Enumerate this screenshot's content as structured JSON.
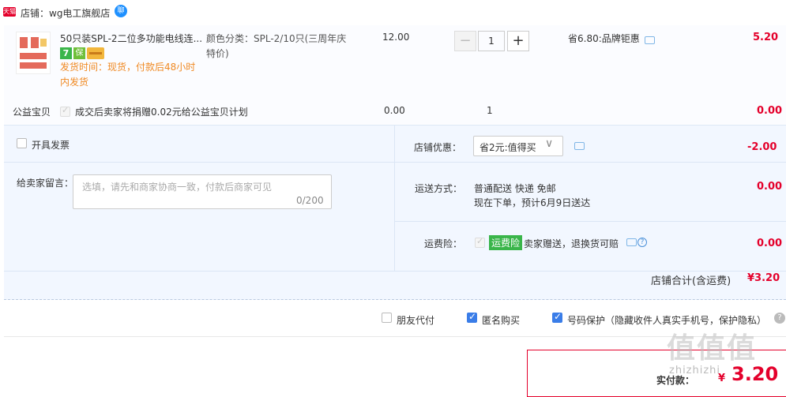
{
  "store": {
    "badge": "天猫",
    "label": "店铺：wg电工旗舰店",
    "chat_icon": "chat-bubble-icon",
    "chat_glyph": "聊"
  },
  "item": {
    "title": "50只装SPL-2二位多功能电线连...",
    "badge7": "7",
    "badge_shield": "保",
    "ship_time": "发货时间：现货，付款后48小时内发货",
    "spec": "颜色分类：SPL-2/10只(三周年庆特价)",
    "unit_price": "12.00",
    "qty_minus": "−",
    "quantity": "1",
    "qty_plus": "+",
    "promo": "省6.80:品牌钜惠",
    "total": "5.20"
  },
  "charity": {
    "label": "公益宝贝",
    "text": "成交后卖家将捐赠0.02元给公益宝贝计划",
    "price": "0.00",
    "qty": "1",
    "total": "0.00"
  },
  "options": {
    "invoice_label": "开具发票",
    "memo_label": "给卖家留言：",
    "memo_placeholder": "选填，请先和商家协商一致，付款后商家可见",
    "memo_count": "0/200",
    "discount_label": "店铺优惠：",
    "discount_value": "省2元:值得买",
    "discount_caret": "∨",
    "discount_amount": "-2.00",
    "shipping_label": "运送方式：",
    "shipping_method": "普通配送 快递 免邮",
    "shipping_eta": "现在下单，预计6月9日送达",
    "shipping_amount": "0.00",
    "insurance_label": "运费险：",
    "insurance_badge": "运费险",
    "insurance_text": "卖家赠送，退换货可赔",
    "insurance_help": "?",
    "insurance_amount": "0.00",
    "store_total_label": "店铺合计(含运费)",
    "store_total": "¥3.20"
  },
  "bottom": {
    "friend_pay": "朋友代付",
    "anonymous": "匿名购买",
    "phone_protect": "号码保护（隐藏收件人真实手机号，保护隐私）",
    "help_glyph": "?",
    "pay_label": "实付款：",
    "pay_currency": "¥",
    "pay_amount": "3.20"
  },
  "watermark": {
    "main": "值值值",
    "sub": "zhizhizhi"
  },
  "colors": {
    "accent": "#e4002b",
    "link": "#3a7de8",
    "green": "#3ab54a",
    "orange": "#f08a24"
  }
}
